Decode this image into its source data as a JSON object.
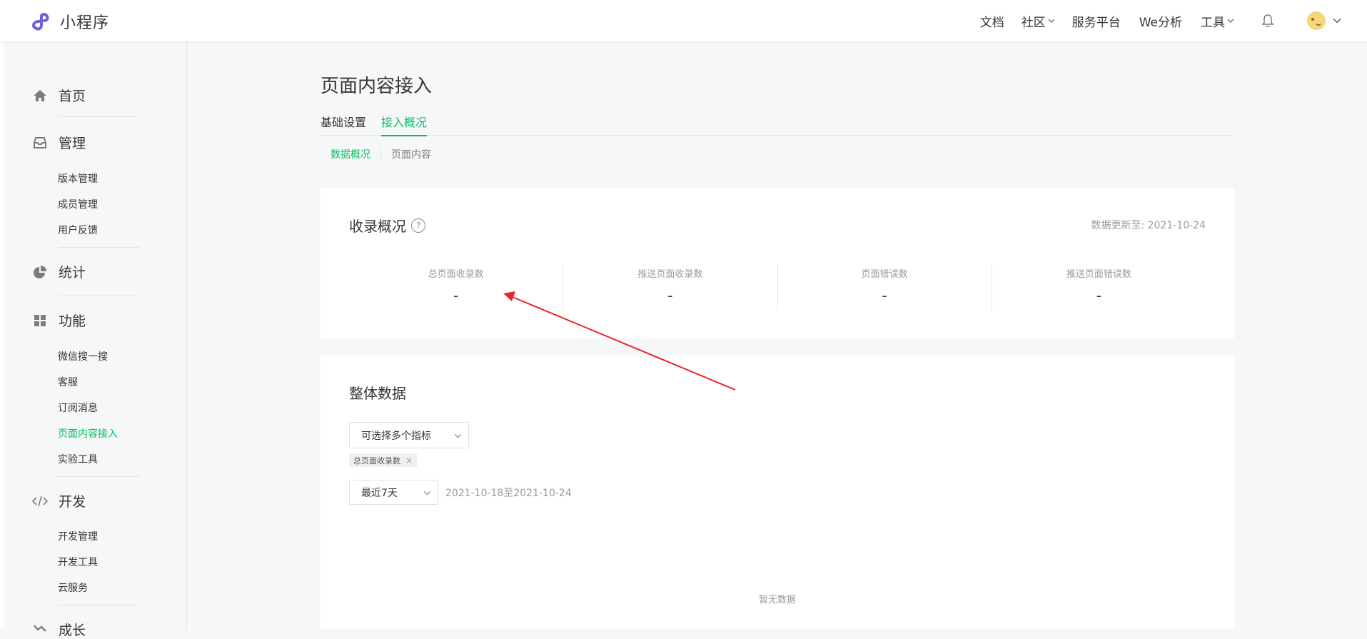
{
  "header": {
    "logo_text": "小程序",
    "nav": {
      "docs": "文档",
      "community": "社区",
      "service_platform": "服务平台",
      "we_analytics": "We分析",
      "tools": "工具"
    }
  },
  "sidebar": {
    "home": "首页",
    "manage": {
      "label": "管理",
      "items": [
        "版本管理",
        "成员管理",
        "用户反馈"
      ]
    },
    "stats": "统计",
    "features": {
      "label": "功能",
      "items": [
        "微信搜一搜",
        "客服",
        "订阅消息",
        "页面内容接入",
        "实验工具"
      ],
      "active_index": 3
    },
    "develop": {
      "label": "开发",
      "items": [
        "开发管理",
        "开发工具",
        "云服务"
      ]
    },
    "growth": "成长"
  },
  "main": {
    "title": "页面内容接入",
    "tabs": [
      "基础设置",
      "接入概况"
    ],
    "active_tab": 1,
    "subtabs": [
      "数据概况",
      "页面内容"
    ],
    "active_subtab": 0,
    "overview": {
      "title": "收录概况",
      "help": "?",
      "update_time": "数据更新至: 2021-10-24",
      "stats": [
        {
          "label": "总页面收录数",
          "value": "-"
        },
        {
          "label": "推送页面收录数",
          "value": "-"
        },
        {
          "label": "页面错误数",
          "value": "-"
        },
        {
          "label": "推送页面错误数",
          "value": "-"
        }
      ]
    },
    "overall": {
      "title": "整体数据",
      "metric_select_placeholder": "可选择多个指标",
      "selected_tag": "总页面收录数",
      "tag_close": "×",
      "period": "最近7天",
      "date_range": "2021-10-18至2021-10-24",
      "empty": "暂无数据"
    }
  },
  "colors": {
    "accent": "#07c160",
    "annotation_arrow": "#e8262a"
  }
}
